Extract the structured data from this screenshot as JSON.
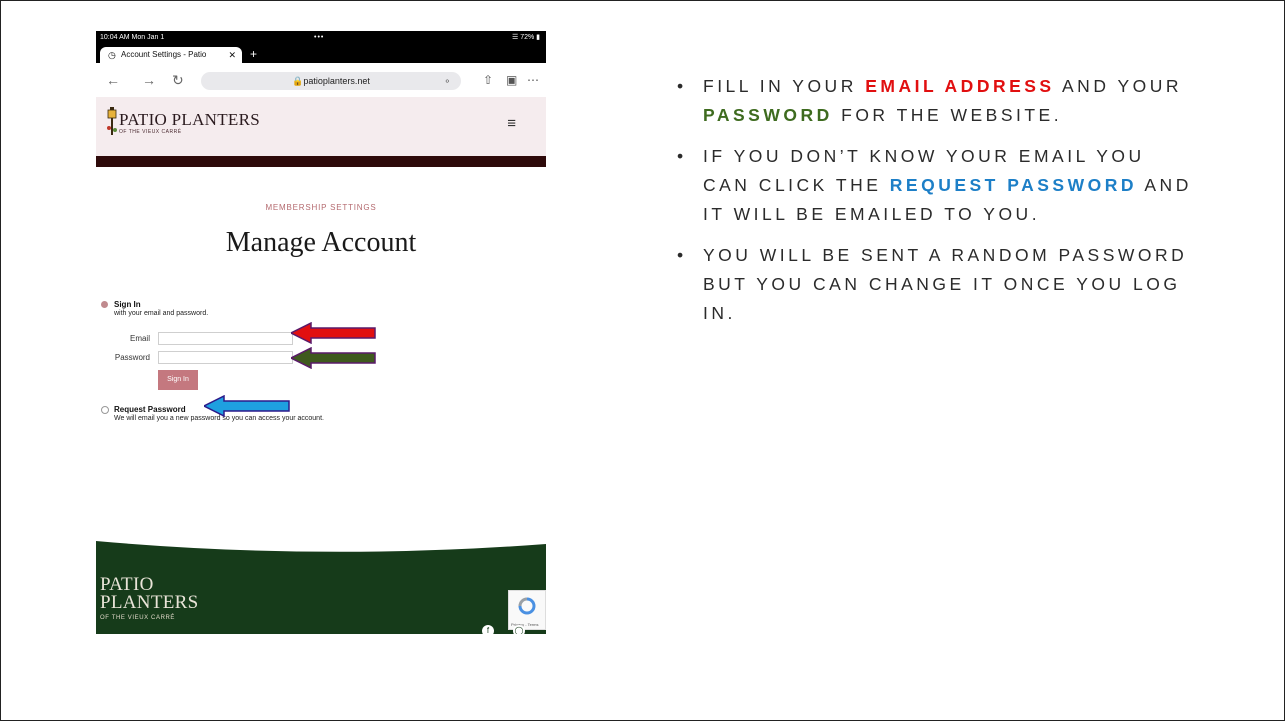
{
  "browser": {
    "status_time": "10:04 AM  Mon Jan 1",
    "status_dots": "•••",
    "battery": "72%",
    "tab_title": "Account Settings - Patio",
    "url": "patioplanters.net"
  },
  "site": {
    "logo_main": "PATIO PLANTERS",
    "logo_sub": "OF THE VIEUX CARRÉ",
    "kicker": "MEMBERSHIP SETTINGS",
    "title": "Manage Account"
  },
  "form": {
    "signin_heading": "Sign In",
    "signin_sub": "with your email and password.",
    "email_label": "Email",
    "password_label": "Password",
    "email_value": "",
    "password_value": "",
    "signin_button": "Sign In",
    "request_heading": "Request Password",
    "request_sub": "We will email you a new password so you can access your account."
  },
  "footer": {
    "name_line1": "PATIO",
    "name_line2": "PLANTERS",
    "sub": "OF THE VIEUX CARRÉ",
    "recaptcha": "Privacy - Terms"
  },
  "instructions": {
    "b1_pre": "FILL IN YOUR ",
    "b1_hl1": "EMAIL ADDRESS",
    "b1_mid": " AND YOUR ",
    "b1_hl2": "PASSWORD",
    "b1_post": " FOR THE WEBSITE.",
    "b2_pre": " IF YOU DON’T KNOW YOUR EMAIL YOU CAN CLICK THE ",
    "b2_hl": "REQUEST PASSWORD",
    "b2_post": " AND IT WILL BE EMAILED TO YOU.",
    "b3": "YOU WILL BE SENT A RANDOM PASSWORD BUT YOU CAN CHANGE IT ONCE YOU LOG IN."
  },
  "colors": {
    "email_arrow": "#e10f10",
    "password_arrow": "#3f5a1e",
    "request_arrow": "#1ea0e0",
    "footer_green": "#163b1a",
    "maroon": "#2e0a0a"
  },
  "icons": [
    "globe-icon",
    "close-icon",
    "plus-icon",
    "back-icon",
    "forward-icon",
    "reload-icon",
    "lock-icon",
    "mic-icon",
    "share-icon",
    "tabs-icon",
    "more-icon",
    "lamp-logo-icon",
    "hamburger-icon",
    "facebook-icon",
    "instagram-icon",
    "recaptcha-icon"
  ]
}
